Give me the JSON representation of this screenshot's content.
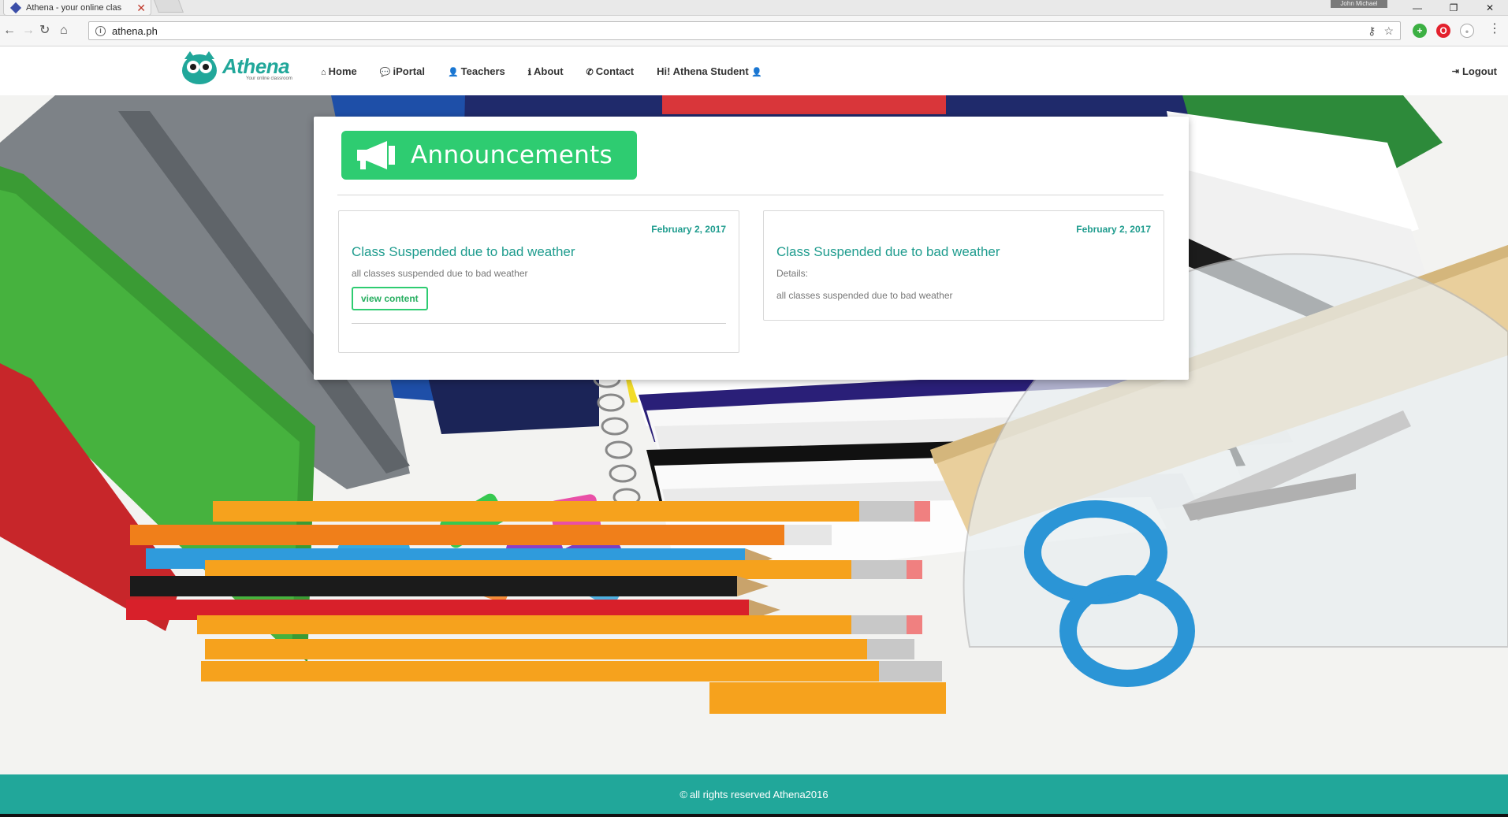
{
  "browser": {
    "tab_title": "Athena - your online clas",
    "tab_close": "✕",
    "profile_name": "John Michael",
    "url": "athena.ph",
    "window_controls": [
      "—",
      "❐",
      "✕"
    ]
  },
  "site": {
    "logo_text": "Athena",
    "logo_tagline": "Your online classroom",
    "nav": [
      {
        "icon": "⌂",
        "label": "Home"
      },
      {
        "icon": "💬",
        "label": "iPortal"
      },
      {
        "icon": "👤",
        "label": "Teachers"
      },
      {
        "icon": "ℹ",
        "label": "About"
      },
      {
        "icon": "✆",
        "label": "Contact"
      },
      {
        "icon": "👤",
        "label": "Hi! Athena Student"
      }
    ],
    "logout": {
      "icon": "⇥",
      "label": "Logout"
    }
  },
  "announcements": {
    "heading": "Announcements",
    "cards": [
      {
        "date": "February 2, 2017",
        "title": "Class Suspended due to bad weather",
        "description": "all classes suspended due to bad weather",
        "button": "view content"
      },
      {
        "date": "February 2, 2017",
        "title": "Class Suspended due to bad weather",
        "details_label": "Details:",
        "description": "all classes suspended due to bad weather"
      }
    ]
  },
  "footer": {
    "symbol": "©",
    "text": "all rights reserved Athena2016"
  },
  "colors": {
    "brand_teal": "#21a79a",
    "announcement_green": "#2ecc71",
    "link_teal": "#1f9c8e"
  }
}
